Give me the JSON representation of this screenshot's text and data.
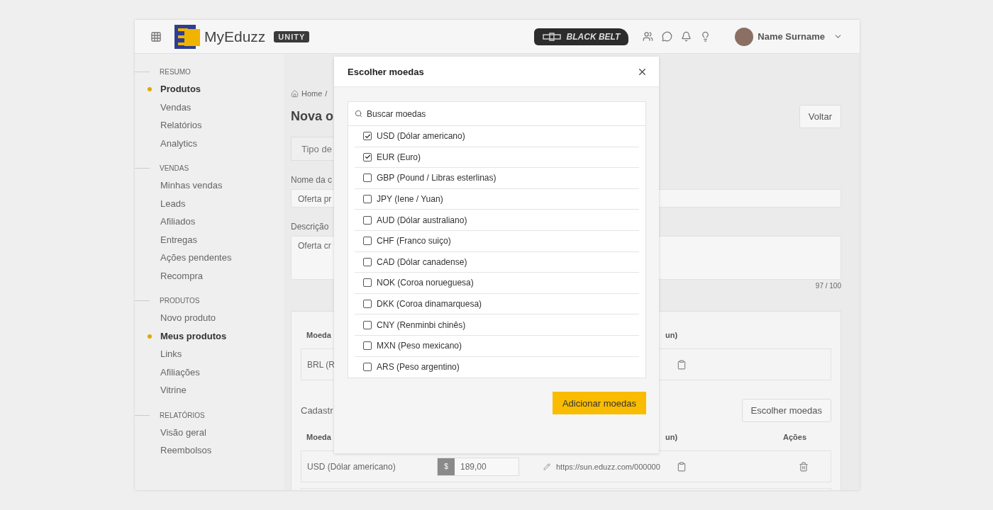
{
  "header": {
    "logo_text": "MyEduzz",
    "badge": "UNITY",
    "rank_badge": "BLACK BELT",
    "user_name": "Name Surname"
  },
  "sidebar": {
    "sections": [
      {
        "title": "RESUMO",
        "items": [
          {
            "label": "Produtos",
            "selected": true
          },
          {
            "label": "Vendas",
            "selected": false
          },
          {
            "label": "Relatórios",
            "selected": false
          },
          {
            "label": "Analytics",
            "selected": false
          }
        ]
      },
      {
        "title": "VENDAS",
        "items": [
          {
            "label": "Minhas vendas",
            "selected": false
          },
          {
            "label": "Leads",
            "selected": false
          },
          {
            "label": "Afiliados",
            "selected": false
          },
          {
            "label": "Entregas",
            "selected": false
          },
          {
            "label": "Ações pendentes",
            "selected": false
          },
          {
            "label": "Recompra",
            "selected": false
          }
        ]
      },
      {
        "title": "PRODUTOS",
        "items": [
          {
            "label": "Novo produto",
            "selected": false
          },
          {
            "label": "Meus produtos",
            "selected": true
          },
          {
            "label": "Links",
            "selected": false
          },
          {
            "label": "Afiliações",
            "selected": false
          },
          {
            "label": "Vitrine",
            "selected": false
          }
        ]
      },
      {
        "title": "RELATÓRIOS",
        "items": [
          {
            "label": "Visão geral",
            "selected": false
          },
          {
            "label": "Reembolsos",
            "selected": false
          }
        ]
      }
    ]
  },
  "main": {
    "breadcrumb": [
      "Home",
      "/"
    ],
    "title": "Nova o",
    "back_button": "Voltar",
    "type_select": "Tipo de",
    "name_label": "Nome da c",
    "name_value": "Oferta pr",
    "description_label": "Descrição",
    "description_value": "Oferta cr",
    "counter": "97 / 100",
    "price_card": {
      "columns": [
        "Moeda",
        "un)"
      ],
      "row": {
        "currency": "BRL (R"
      }
    },
    "registered": {
      "label": "Cadastr",
      "button": "Escolher moedas",
      "columns": [
        "Moeda",
        "un)",
        "Ações"
      ],
      "rows": [
        {
          "currency": "USD (Dólar americano)",
          "symbol": "$",
          "price": "189,00",
          "link": "https://sun.eduzz.com/000000"
        }
      ]
    }
  },
  "modal": {
    "title": "Escolher moedas",
    "search": {
      "placeholder": "Buscar moedas"
    },
    "currencies": [
      {
        "label": "USD (Dólar americano)",
        "checked": true
      },
      {
        "label": "EUR (Euro)",
        "checked": true
      },
      {
        "label": "GBP (Pound / Libras esterlinas)",
        "checked": false
      },
      {
        "label": "JPY (Iene / Yuan)",
        "checked": false
      },
      {
        "label": "AUD (Dólar australiano)",
        "checked": false
      },
      {
        "label": "CHF (Franco suiço)",
        "checked": false
      },
      {
        "label": "CAD (Dólar canadense)",
        "checked": false
      },
      {
        "label": "NOK (Coroa norueguesa)",
        "checked": false
      },
      {
        "label": "DKK (Coroa dinamarquesa)",
        "checked": false
      },
      {
        "label": "CNY (Renminbi chinês)",
        "checked": false
      },
      {
        "label": "MXN (Peso mexicano)",
        "checked": false
      },
      {
        "label": "ARS (Peso argentino)",
        "checked": false
      }
    ],
    "submit_button": "Adicionar moedas"
  }
}
